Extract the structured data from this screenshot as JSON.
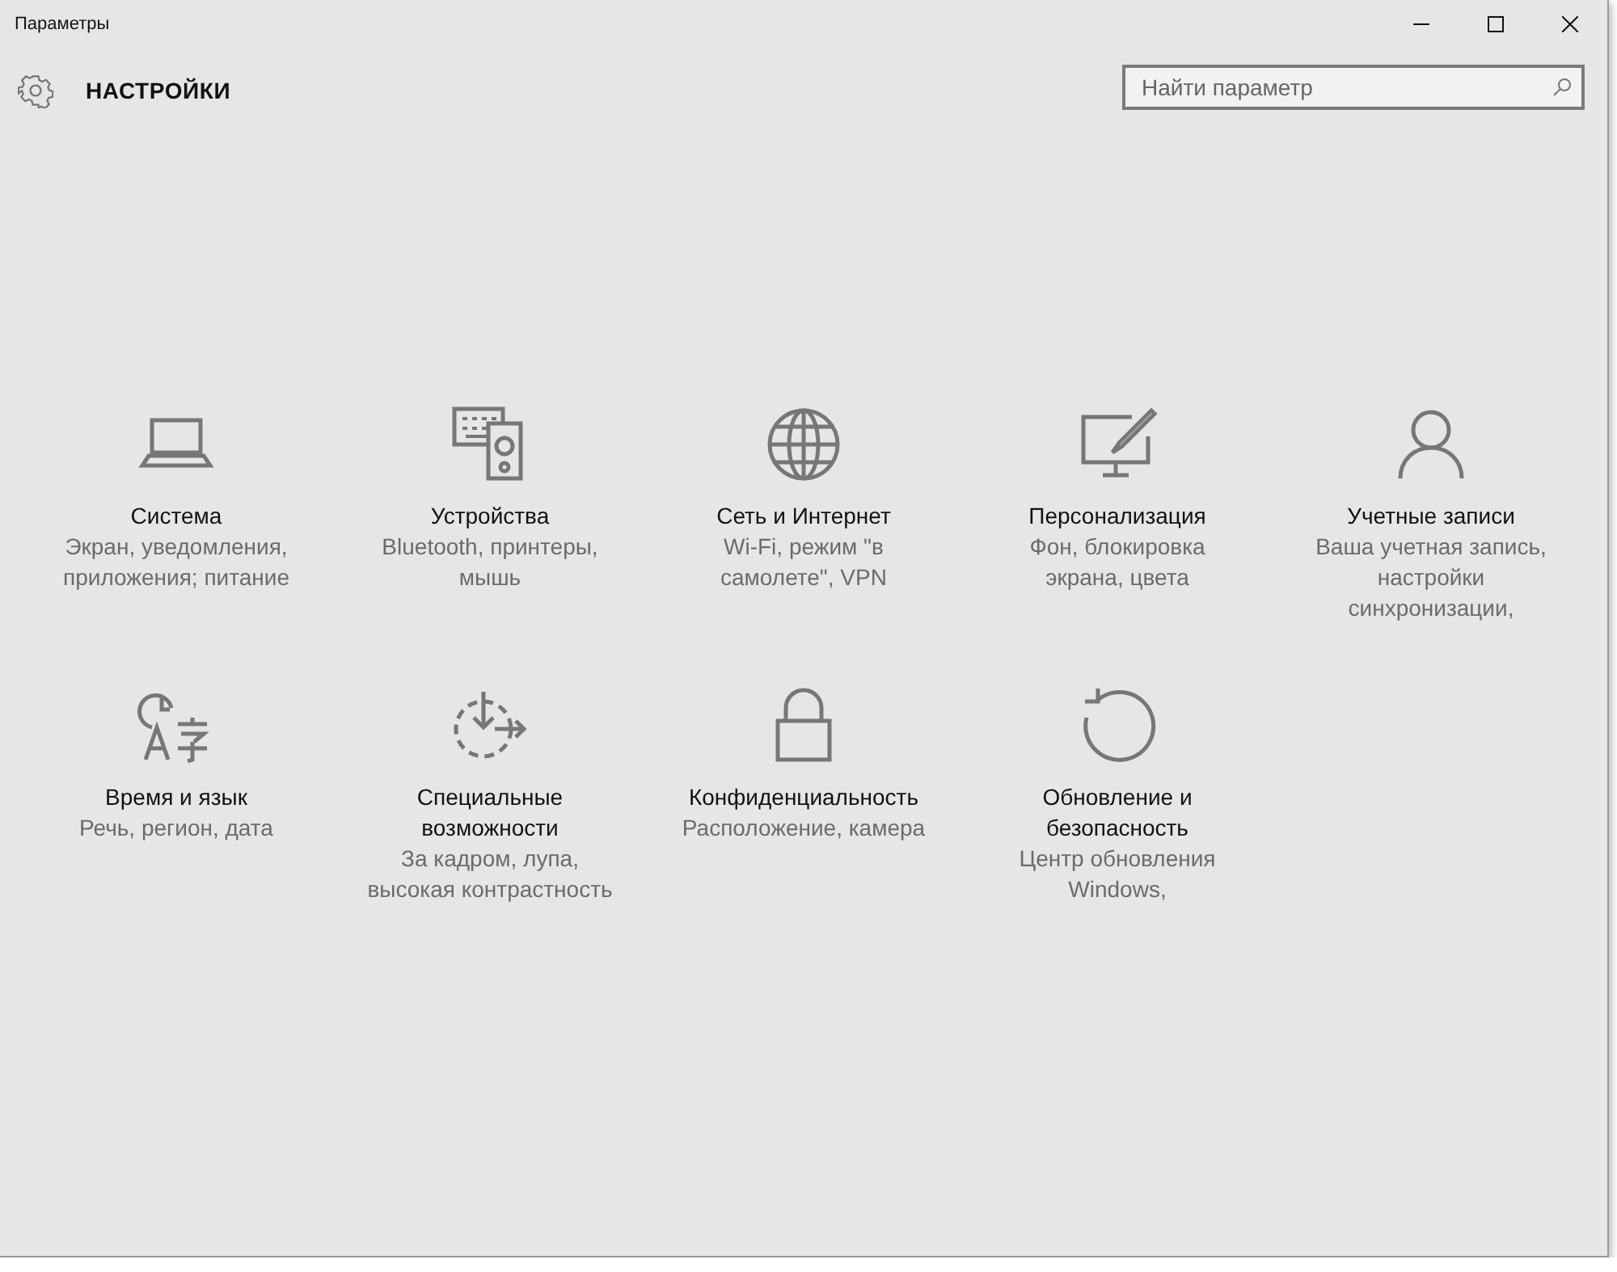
{
  "window": {
    "title": "Параметры"
  },
  "header": {
    "title": "НАСТРОЙКИ"
  },
  "search": {
    "placeholder": "Найти параметр"
  },
  "tiles": [
    {
      "kind": "laptop",
      "title": "Система",
      "subtitle": "Экран, уведомления, приложения; питание"
    },
    {
      "kind": "devices",
      "title": "Устройства",
      "subtitle": "Bluetooth, принтеры, мышь"
    },
    {
      "kind": "globe",
      "title": "Сеть и Интернет",
      "subtitle": "Wi-Fi, режим \"в самолете\", VPN"
    },
    {
      "kind": "paint",
      "title": "Персонализация",
      "subtitle": "Фон, блокировка экрана, цвета"
    },
    {
      "kind": "person",
      "title": "Учетные записи",
      "subtitle": "Ваша учетная запись, настройки синхронизации,"
    },
    {
      "kind": "language",
      "title": "Время и язык",
      "subtitle": "Речь, регион, дата"
    },
    {
      "kind": "access",
      "title": "Специальные возможности",
      "subtitle": "За кадром, лупа, высокая контрастность"
    },
    {
      "kind": "lock",
      "title": "Конфиденциальность",
      "subtitle": "Расположение, камера"
    },
    {
      "kind": "update",
      "title": "Обновление и безопасность",
      "subtitle": "Центр обновления Windows,"
    }
  ]
}
